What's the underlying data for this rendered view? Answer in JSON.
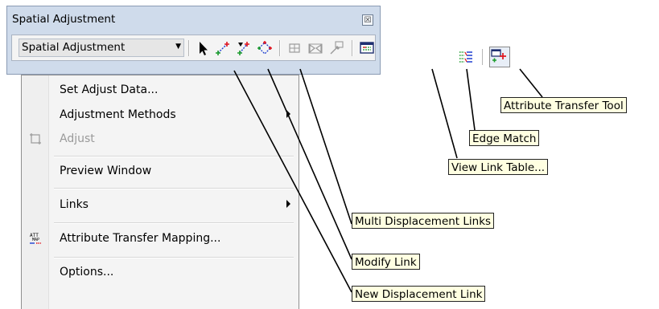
{
  "window": {
    "title": "Spatial Adjustment",
    "close_label": "☒"
  },
  "toolbar": {
    "dropdown_label": "Spatial Adjustment",
    "dropdown_arrow": "▼",
    "tools": [
      {
        "name": "select-elements-tool",
        "icon": "arrow-icon",
        "enabled": true
      },
      {
        "name": "new-displacement-link-tool",
        "icon": "new-link-icon",
        "enabled": true
      },
      {
        "name": "modify-link-tool",
        "icon": "modify-link-icon",
        "enabled": true
      },
      {
        "name": "multi-displacement-links-tool",
        "icon": "multi-link-icon",
        "enabled": true
      },
      {
        "name": "new-limited-adjustment-area-tool",
        "icon": "limited-area-icon",
        "enabled": false
      },
      {
        "name": "new-identity-link-tool",
        "icon": "identity-link-icon",
        "enabled": false
      },
      {
        "name": "clear-limited-adjustment-area-tool",
        "icon": "clear-area-icon",
        "enabled": false
      },
      {
        "name": "view-link-table-tool",
        "icon": "table-icon",
        "enabled": true
      },
      {
        "name": "edge-match-tool",
        "icon": "edge-match-icon",
        "enabled": true
      },
      {
        "name": "attribute-transfer-tool",
        "icon": "attribute-transfer-icon",
        "enabled": true
      }
    ]
  },
  "menu": {
    "items": [
      {
        "label": "Set Adjust Data...",
        "enabled": true,
        "submenu": false
      },
      {
        "label": "Adjustment Methods",
        "enabled": true,
        "submenu": true
      },
      {
        "label": "Adjust",
        "enabled": false,
        "submenu": false,
        "icon": "adjust-icon"
      },
      {
        "label": "Preview Window",
        "enabled": true,
        "submenu": false
      },
      {
        "label": "Links",
        "enabled": true,
        "submenu": true
      },
      {
        "label": "Attribute Transfer Mapping...",
        "enabled": true,
        "submenu": false,
        "icon": "attribute-mapping-icon"
      },
      {
        "label": "Options...",
        "enabled": true,
        "submenu": false
      }
    ]
  },
  "callouts": {
    "attribute_transfer_tool": "Attribute Transfer Tool",
    "edge_match": "Edge Match",
    "view_link_table": "View Link Table...",
    "multi_displacement_links": "Multi Displacement Links",
    "modify_link": "Modify Link",
    "new_displacement_link": "New Displacement Link"
  },
  "colors": {
    "window_frame": "#cfdbeb",
    "callout_bg": "#ffffe1",
    "link_red": "#e0141e",
    "link_green": "#1a9c2a",
    "link_blue": "#1e3fd0"
  }
}
